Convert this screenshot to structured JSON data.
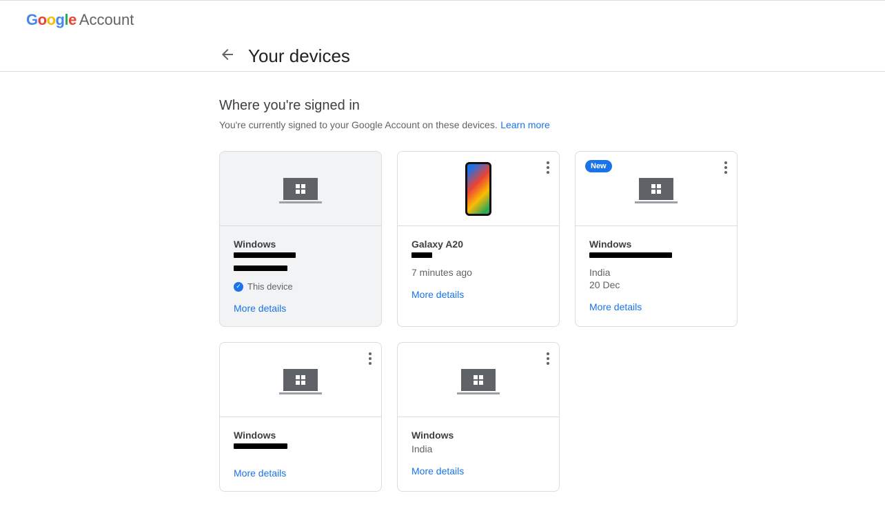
{
  "header": {
    "logo_letters": [
      "G",
      "o",
      "o",
      "g",
      "l",
      "e"
    ],
    "account_label": "Account",
    "page_title": "Your devices"
  },
  "section": {
    "heading": "Where you're signed in",
    "description": "You're currently signed to your Google Account on these devices.",
    "learn_more": "Learn more"
  },
  "labels": {
    "more_details": "More details",
    "this_device": "This device",
    "new_badge": "New"
  },
  "devices": [
    {
      "name": "Windows",
      "type": "laptop",
      "is_current": true,
      "show_menu": false,
      "redacted_lines": [
        90,
        78
      ],
      "meta": [],
      "badge": null
    },
    {
      "name": "Galaxy A20",
      "type": "phone",
      "is_current": false,
      "show_menu": true,
      "redacted_lines": [
        30
      ],
      "meta": [
        "7 minutes ago"
      ],
      "badge": null
    },
    {
      "name": "Windows",
      "type": "laptop",
      "is_current": false,
      "show_menu": true,
      "redacted_lines": [
        120
      ],
      "meta": [
        "India",
        "20 Dec"
      ],
      "badge": "new"
    },
    {
      "name": "Windows",
      "type": "laptop",
      "is_current": false,
      "show_menu": true,
      "redacted_lines": [
        78
      ],
      "meta": [],
      "badge": null
    },
    {
      "name": "Windows",
      "type": "laptop",
      "is_current": false,
      "show_menu": true,
      "redacted_lines": [],
      "meta": [
        "India"
      ],
      "badge": null
    }
  ]
}
